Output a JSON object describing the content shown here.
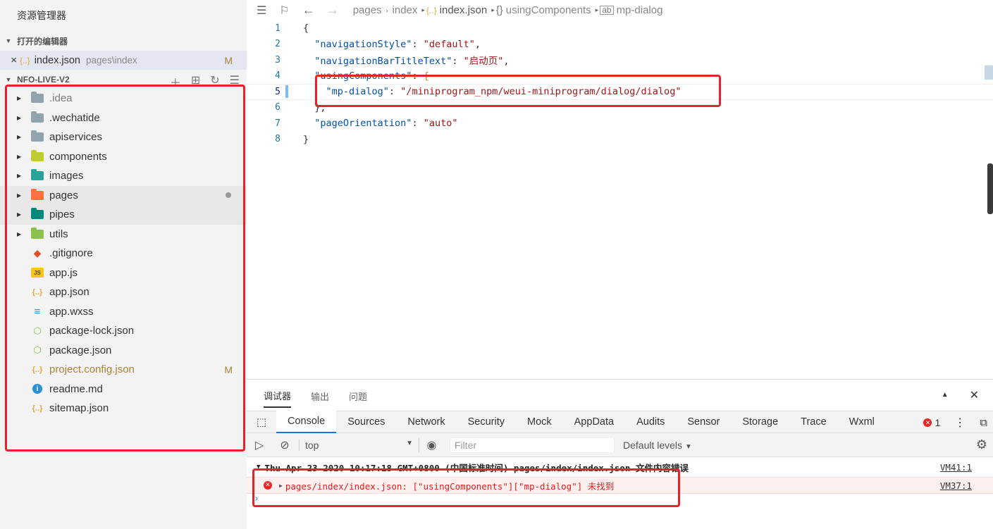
{
  "sidebar": {
    "title": "资源管理器",
    "open_editors_label": "打开的编辑器",
    "open_file": {
      "name": "index.json",
      "path": "pages\\index",
      "badge": "M"
    },
    "project_label": "NFO-LIVE-V2",
    "items": [
      {
        "name": ".idea",
        "type": "folder",
        "color": "#90a4ae"
      },
      {
        "name": ".wechatide",
        "type": "folder",
        "color": "#90a4ae"
      },
      {
        "name": "apiservices",
        "type": "folder",
        "color": "#90a4ae"
      },
      {
        "name": "components",
        "type": "folder",
        "color": "#c0ca33"
      },
      {
        "name": "images",
        "type": "folder",
        "color": "#26a69a"
      },
      {
        "name": "pages",
        "type": "folder",
        "color": "#ff7043"
      },
      {
        "name": "pipes",
        "type": "folder",
        "color": "#00897b"
      },
      {
        "name": "utils",
        "type": "folder",
        "color": "#8bc34a"
      },
      {
        "name": ".gitignore",
        "type": "git-icon"
      },
      {
        "name": "app.js",
        "type": "js-icon"
      },
      {
        "name": "app.json",
        "type": "json-icon"
      },
      {
        "name": "app.wxss",
        "type": "css-icon"
      },
      {
        "name": "package-lock.json",
        "type": "node-icon"
      },
      {
        "name": "package.json",
        "type": "node-icon"
      },
      {
        "name": "project.config.json",
        "type": "json-icon",
        "badge": "M"
      },
      {
        "name": "readme.md",
        "type": "info-icon"
      },
      {
        "name": "sitemap.json",
        "type": "json-icon"
      }
    ]
  },
  "breadcrumbs": {
    "b1": "pages",
    "b2": "index",
    "b3": "index.json",
    "b4": "usingComponents",
    "b5": "mp-dialog"
  },
  "code": {
    "l1": "{",
    "l2k": "\"navigationStyle\"",
    "l2v": "\"default\"",
    "l3k": "\"navigationBarTitleText\"",
    "l3v": "\"启动页\"",
    "l4k": "\"usingComponents\"",
    "l5k": "\"mp-dialog\"",
    "l5v": "\"/miniprogram_npm/weui-miniprogram/dialog/dialog\"",
    "l6": "},",
    "l7k": "\"pageOrientation\"",
    "l7v": "\"auto\"",
    "l8": "}"
  },
  "devtools": {
    "top_tabs": {
      "t1": "调试器",
      "t2": "输出",
      "t3": "问题"
    },
    "panel_tabs": {
      "console": "Console",
      "sources": "Sources",
      "network": "Network",
      "security": "Security",
      "mock": "Mock",
      "appdata": "AppData",
      "audits": "Audits",
      "sensor": "Sensor",
      "storage": "Storage",
      "trace": "Trace",
      "wxml": "Wxml"
    },
    "error_count": "1",
    "context": "top",
    "filter_placeholder": "Filter",
    "levels": "Default levels",
    "group_text": "Thu Apr 23 2020 10:17:18 GMT+0800 (中国标准时间) pages/index/index.json 文件内容错误",
    "group_src": "VM41:1",
    "error_text": "pages/index/index.json: [\"usingComponents\"][\"mp-dialog\"] 未找到",
    "error_src": "VM37:1"
  }
}
